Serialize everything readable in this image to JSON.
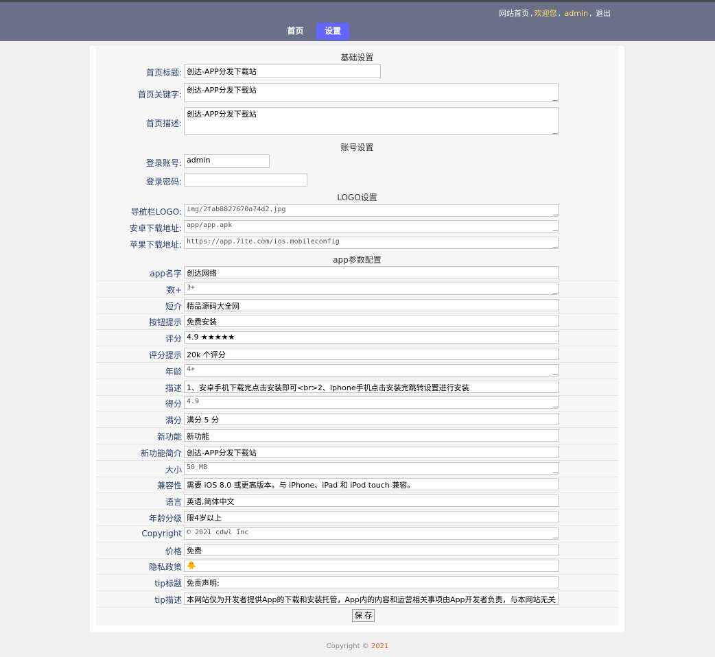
{
  "header": {
    "site_home": "网站首页",
    "welcome": "欢迎您",
    "username": "admin",
    "logout": "退出",
    "nav": [
      "首页",
      "设置"
    ]
  },
  "basic": {
    "title": "基础设置",
    "home_title_label": "首页标题:",
    "home_title_value": "创达-APP分发下载站",
    "keywords_label": "首页关键字:",
    "keywords_value": "创达-APP分发下载站",
    "desc_label": "首页描述:",
    "desc_value": "创达-APP分发下载站"
  },
  "account": {
    "title": "账号设置",
    "login_label": "登录账号:",
    "login_value": "admin",
    "password_label": "登录密码:",
    "password_value": ""
  },
  "logo": {
    "title": "LOGO设置",
    "nav_logo_label": "导航栏LOGO:",
    "nav_logo_value": "img/2fab8827670a74d2.jpg",
    "android_label": "安卓下载地址:",
    "android_value": "app/app.apk",
    "ios_label": "苹果下载地址:",
    "ios_value": "https://app.7ite.com/ios.mobileconfig"
  },
  "app": {
    "title": "app参数配置",
    "fields": [
      {
        "label": "app名字",
        "value": "创达网络"
      },
      {
        "label": "数+",
        "value": "3+"
      },
      {
        "label": "短介",
        "value": "精品源码大全网"
      },
      {
        "label": "按钮提示",
        "value": "免费安装"
      },
      {
        "label": "评分",
        "value": "4.9 ★★★★★"
      },
      {
        "label": "评分提示",
        "value": "20k 个评分"
      },
      {
        "label": "年龄",
        "value": "4+"
      },
      {
        "label": "描述",
        "value": "1、安卓手机下载完点击安装即可<br>2、Iphone手机点击安装完跳转设置进行安装"
      },
      {
        "label": "得分",
        "value": "4.9"
      },
      {
        "label": "满分",
        "value": "满分 5 分"
      },
      {
        "label": "新功能",
        "value": "新功能"
      },
      {
        "label": "新功能简介",
        "value": "创达-APP分发下载站"
      },
      {
        "label": "大小",
        "value": "50 MB"
      },
      {
        "label": "兼容性",
        "value": "需要 iOS 8.0 或更高版本。与 iPhone、iPad 和 iPod touch 兼容。"
      },
      {
        "label": "语言",
        "value": "英语,简体中文"
      },
      {
        "label": "年龄分级",
        "value": "限4岁以上"
      },
      {
        "label": "Copyright",
        "value": "© 2021 cdwl Inc"
      },
      {
        "label": "价格",
        "value": "免费"
      },
      {
        "label": "隐私政策",
        "value": "🐥"
      },
      {
        "label": "tip标题",
        "value": "免责声明:"
      },
      {
        "label": "tip描述",
        "value": "本网站仅为开发者提供App的下载和安装托管，App内的内容和运营相关事项由App开发者负责，与本网站无关"
      }
    ]
  },
  "save_label": "保 存",
  "footer": {
    "text": "Copyright © ",
    "year": "2021"
  },
  "colors": {
    "topbar": "#6b7089",
    "nav_active": "#6464ff",
    "label": "#2a3f6e",
    "footer_year": "#e06020"
  }
}
